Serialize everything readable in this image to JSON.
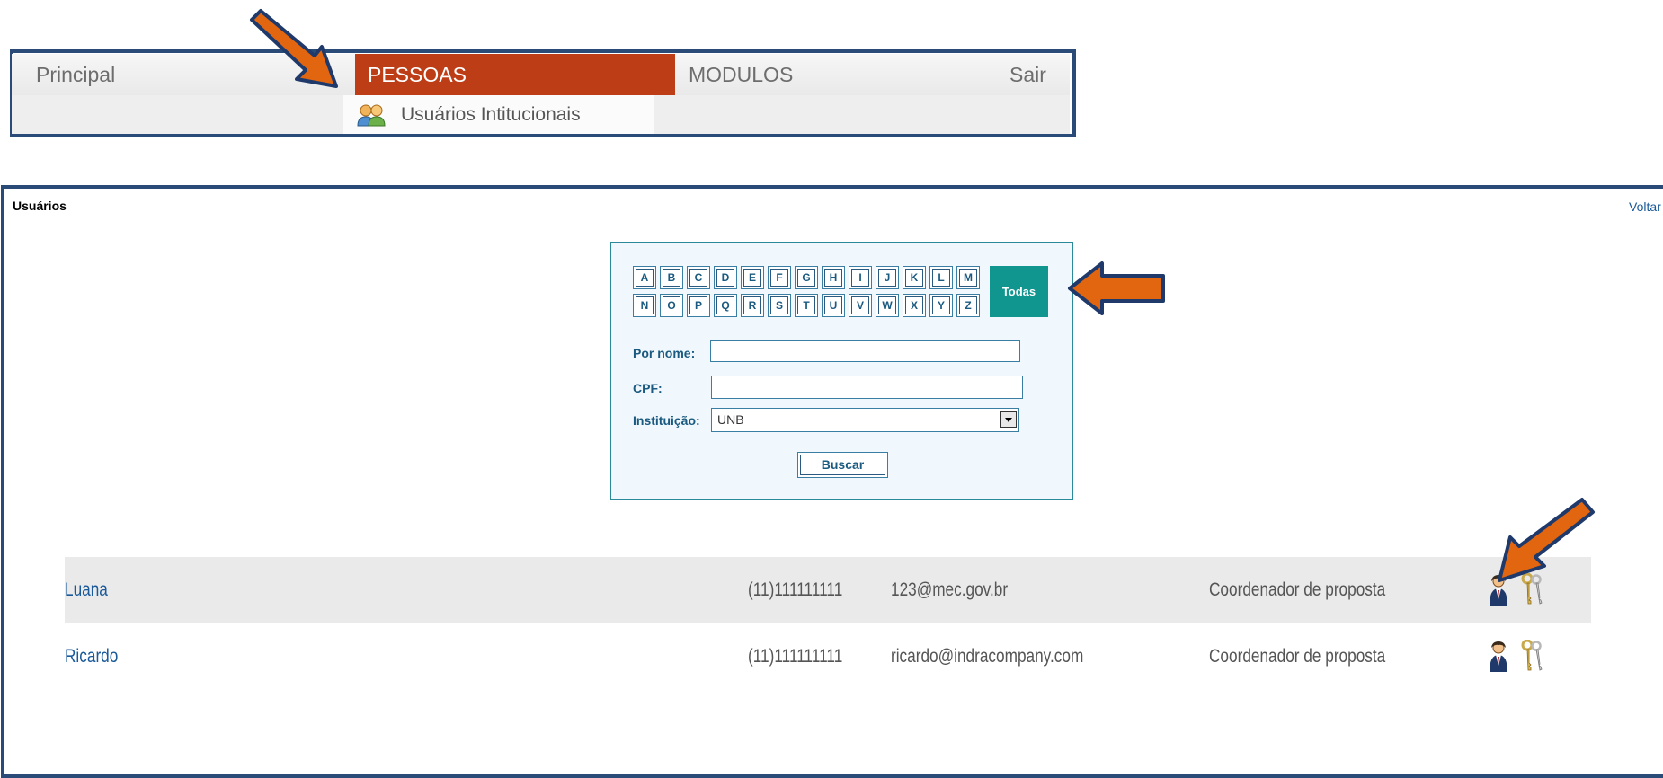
{
  "menu": {
    "items": [
      "Principal",
      "PESSOAS",
      "MODULOS",
      "Sair"
    ],
    "submenu_label": "Usuários Intitucionais"
  },
  "page": {
    "title": "Usuários",
    "back_link": "Voltar"
  },
  "search": {
    "letters_row1": [
      "A",
      "B",
      "C",
      "D",
      "E",
      "F",
      "G",
      "H",
      "I",
      "J",
      "K",
      "L",
      "M"
    ],
    "letters_row2": [
      "N",
      "O",
      "P",
      "Q",
      "R",
      "S",
      "T",
      "U",
      "V",
      "W",
      "X",
      "Y",
      "Z"
    ],
    "all_label": "Todas",
    "name_label": "Por nome:",
    "name_value": "",
    "cpf_label": "CPF:",
    "cpf_value": "",
    "institution_label": "Instituição:",
    "institution_value": "UNB",
    "submit_label": "Buscar"
  },
  "users": [
    {
      "name": "Luana",
      "phone": "(11)111111111",
      "email": "123@mec.gov.br",
      "role": "Coordenador de proposta"
    },
    {
      "name": "Ricardo",
      "phone": "(11)111111111",
      "email": "ricardo@indracompany.com",
      "role": "Coordenador de proposta"
    }
  ],
  "colors": {
    "menu_active": "#bd3d16",
    "frame_border": "#2a4a78",
    "todas_bg": "#11958f",
    "link": "#1a5a9a",
    "annotation_arrow": "#e2660f"
  },
  "icons": [
    "people-icon",
    "user-icon",
    "key-icon",
    "arrow-annotation-icon"
  ]
}
